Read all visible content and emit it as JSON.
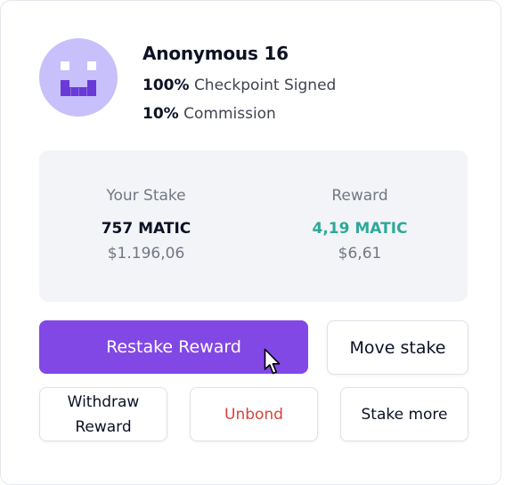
{
  "validator": {
    "name": "Anonymous 16",
    "checkpoint_value": "100%",
    "checkpoint_text": "Checkpoint Signed",
    "commission_value": "10%",
    "commission_text": "Commission",
    "avatar_icon": "pixel-face-icon"
  },
  "stake": {
    "your_stake_label": "Your Stake",
    "your_stake_amount": "757 MATIC",
    "your_stake_usd": "$1.196,06",
    "reward_label": "Reward",
    "reward_amount": "4,19 MATIC",
    "reward_usd": "$6,61"
  },
  "actions": {
    "restake": "Restake Reward",
    "move_stake": "Move stake",
    "withdraw": "Withdraw Reward",
    "unbond": "Unbond",
    "stake_more": "Stake more"
  },
  "colors": {
    "primary": "#8248e5",
    "avatar_bg": "#c7c0fb",
    "avatar_fg": "#6a3ad6",
    "reward": "#2ea89a",
    "danger": "#d9423c",
    "panel_bg": "#f3f4f7"
  }
}
